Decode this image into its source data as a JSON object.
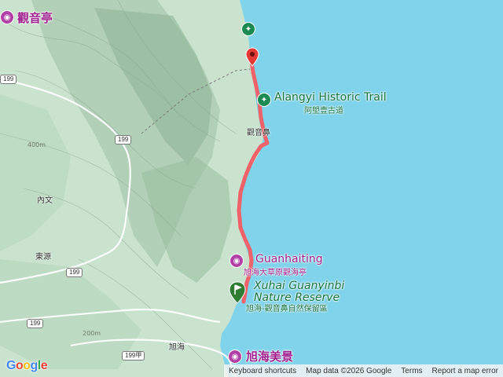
{
  "map": {
    "water_color": "#7fd3ea",
    "land_color": "#c9e3cf",
    "route_color": "#f0626a"
  },
  "pois": {
    "guanyin_pavilion": {
      "label": "觀音亭",
      "icon": "camera-icon"
    },
    "alangyi": {
      "label": "Alangyi Historic Trail",
      "sublabel": "阿塱壹古道",
      "icon": "hiking-icon"
    },
    "guanhaiting": {
      "label": "Guanhaiting",
      "sublabel": "旭海大草原觀海亭",
      "icon": "camera-icon"
    },
    "xuhai_reserve": {
      "label": "Xuhai Guanyinbi",
      "label2": "Nature Reserve",
      "sublabel": "旭海-觀音鼻自然保留區",
      "icon": "park-icon"
    },
    "xuhai_view": {
      "label": "旭海美景",
      "icon": "camera-icon"
    }
  },
  "places": {
    "guanyinbi": "觀音鼻",
    "neiwen": "內文",
    "dongyuan": "東源",
    "xuhai": "旭海"
  },
  "roads": {
    "r199_a": "199",
    "r199_b": "199",
    "r199_c": "199",
    "r199_d": "199",
    "r199jia": "199甲",
    "r199_left": "199"
  },
  "contours": {
    "c400": "400m",
    "c200": "200m"
  },
  "attribution": {
    "logo": "Google",
    "shortcuts": "Keyboard shortcuts",
    "mapdata": "Map data ©2026 Google",
    "terms": "Terms",
    "report": "Report a map error"
  }
}
